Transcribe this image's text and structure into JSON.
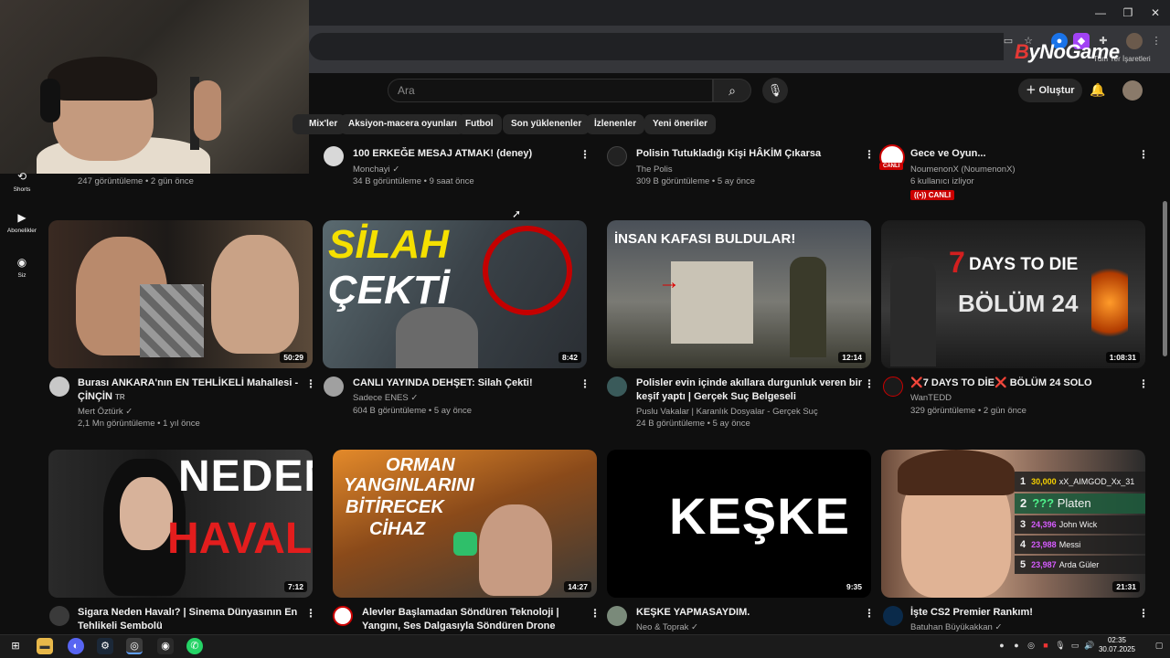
{
  "browser": {
    "window_min": "—",
    "window_max": "❐",
    "window_close": "✕",
    "bookmarks_label": "Tüm Yer İşaretleri"
  },
  "logo": {
    "text_b": "B",
    "text_rest": "yNoGame"
  },
  "header": {
    "search_placeholder": "Ara",
    "create_label": "Oluştur"
  },
  "chips": [
    "Mix'ler",
    "Aksiyon-macera oyunları",
    "Futbol",
    "Son yüklenenler",
    "İzlenenler",
    "Yeni öneriler"
  ],
  "sidebar": [
    {
      "label": "Shorts",
      "icon": "shorts-icon"
    },
    {
      "label": "Abonelikler",
      "icon": "subscriptions-icon"
    },
    {
      "label": "Siz",
      "icon": "you-icon"
    }
  ],
  "row0": [
    {
      "meta": "247 görüntüleme • 2 gün önce"
    },
    {
      "title": "100 ERKEĞE MESAJ ATMAK! (deney)",
      "channel": "Monchayi",
      "meta": "34 B görüntüleme • 9 saat önce"
    },
    {
      "title": "Polisin Tutukladığı Kişi HÂKİM Çıkarsa",
      "channel": "The Polis",
      "meta": "309 B görüntüleme • 5 ay önce"
    },
    {
      "title": "Gece ve Oyun...",
      "channel": "NoumenonX (NoumenonX)",
      "meta": "6 kullanıcı izliyor",
      "live": "CANLI",
      "avatar_badge": "CANLI"
    }
  ],
  "row1": [
    {
      "title": "Burası ANKARA'nın EN TEHLİKELİ Mahallesi - ÇİNÇİN",
      "tag": "TR",
      "channel": "Mert Öztürk",
      "meta": "2,1 Mn görüntüleme • 1 yıl önce",
      "duration": "50:29"
    },
    {
      "title": "CANLI YAYINDA DEHŞET: Silah Çekti!",
      "channel": "Sadece ENES",
      "meta": "604 B görüntüleme • 5 ay önce",
      "duration": "8:42",
      "thumb_text1": "SİLAH",
      "thumb_text2": "ÇEKTİ"
    },
    {
      "title": "Polisler evin içinde akıllara durgunluk veren bir keşif yaptı | Gerçek Suç Belgeseli",
      "channel": "Puslu Vakalar | Karanlık Dosyalar - Gerçek Suç",
      "meta": "24 B görüntüleme • 5 ay önce",
      "duration": "12:14",
      "thumb_text1": "İNSAN KAFASI BULDULAR!"
    },
    {
      "title": "❌7 DAYS TO DİE❌ BÖLÜM 24 SOLO",
      "channel": "WanTEDD",
      "meta": "329 görüntüleme • 2 gün önce",
      "duration": "1:08:31",
      "thumb_text1": "7",
      "thumb_text2": "DAYS TO DIE",
      "thumb_text3": "BÖLÜM 24"
    }
  ],
  "row2": [
    {
      "title": "Sigara Neden Havalı? | Sinema Dünyasının En Tehlikeli Sembolü",
      "duration": "7:12",
      "thumb_text1": "NEDEN",
      "thumb_text2": "HAVALI?"
    },
    {
      "title": "Alevler Başlamadan Söndüren Teknoloji | Yangını, Ses Dalgasıyla Söndüren Drone Geliyor",
      "duration": "14:27",
      "thumb_text1": "ORMAN",
      "thumb_text2": "YANGINLARINI",
      "thumb_text3": "BİTİRECEK",
      "thumb_text4": "CİHAZ"
    },
    {
      "title": "KEŞKE YAPMASAYDIM.",
      "channel": "Neo & Toprak",
      "duration": "9:35",
      "thumb_text1": "KEŞKE"
    },
    {
      "title": "İşte CS2 Premier Rankım!",
      "channel": "Batuhan Büyükakkan",
      "duration": "21:31",
      "leaderboard": [
        {
          "rank": "1",
          "score": "30,000",
          "name": "xX_AIMGOD_Xx_31"
        },
        {
          "rank": "2",
          "score": "???",
          "name": "Platen"
        },
        {
          "rank": "3",
          "score": "24,396",
          "name": "John Wick"
        },
        {
          "rank": "4",
          "score": "23,988",
          "name": "Messi"
        },
        {
          "rank": "5",
          "score": "23,987",
          "name": "Arda Güler"
        }
      ]
    }
  ],
  "taskbar": {
    "time": "02:35",
    "date": "30.07.2025"
  },
  "colors": {
    "accent": "#cc0000",
    "background": "#0f0f0f",
    "chip": "#272727"
  }
}
